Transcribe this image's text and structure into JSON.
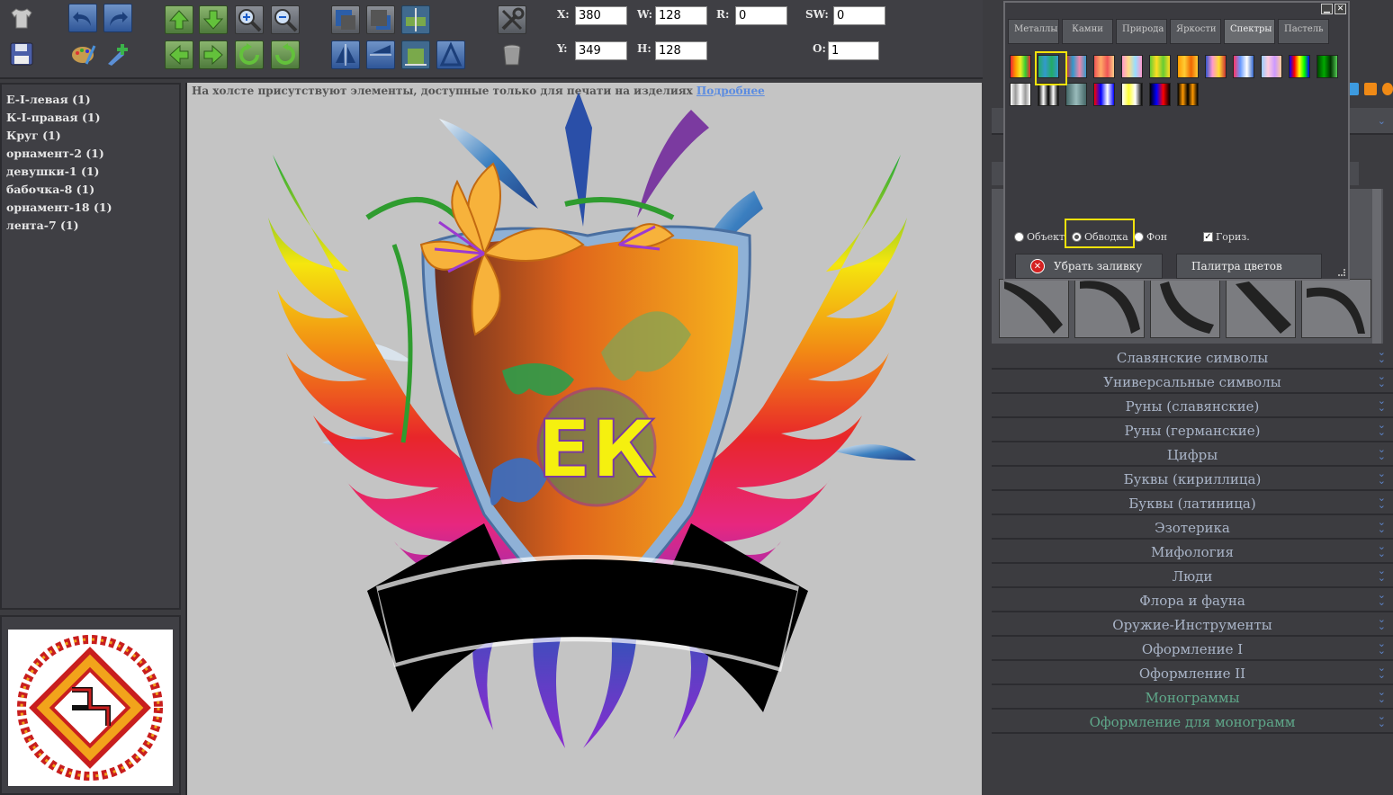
{
  "coords": {
    "x_label": "X:",
    "x_value": "380",
    "y_label": "Y:",
    "y_value": "349",
    "w_label": "W:",
    "w_value": "128",
    "h_label": "H:",
    "h_value": "128",
    "r_label": "R:",
    "r_value": "0",
    "sw_label": "SW:",
    "sw_value": "0",
    "o_label": "O:",
    "o_value": "1"
  },
  "layers": [
    "E-I-левая (1)",
    "К-I-правая (1)",
    "Круг (1)",
    "орнамент-2 (1)",
    "девушки-1 (1)",
    "бабочка-8 (1)",
    "орнамент-18 (1)",
    "лента-7 (1)"
  ],
  "notice": {
    "text": "На холсте присутствуют элементы, доступные только для печати на изделиях",
    "link": "Подробнее"
  },
  "palette": {
    "tabs": [
      "Металлы",
      "Камни",
      "Природа",
      "Яркости",
      "Спектры",
      "Пастель"
    ],
    "active_tab": "Спектры",
    "radio_object": "Объект",
    "radio_stroke": "Обводка",
    "radio_bg": "Фон",
    "check_horiz": "Гориз.",
    "remove_fill": "Убрать заливку",
    "color_palette": "Палитра цветов"
  },
  "categories": [
    "Славянские символы",
    "Универсальные символы",
    "Руны (славянские)",
    "Руны (германские)",
    "Цифры",
    "Буквы (кириллица)",
    "Буквы (латиница)",
    "Эзотерика",
    "Мифология",
    "Люди",
    "Флора и фауна",
    "Оружие-Инструменты",
    "Оформление I",
    "Оформление II",
    "Монограммы",
    "Оформление для монограмм"
  ],
  "monogram_letters": "ЕК",
  "colors": {
    "selection": "#f2e20c",
    "link": "#5c8ce0",
    "category_text": "#aab5c8",
    "category_highlight": "#5fa88a"
  }
}
